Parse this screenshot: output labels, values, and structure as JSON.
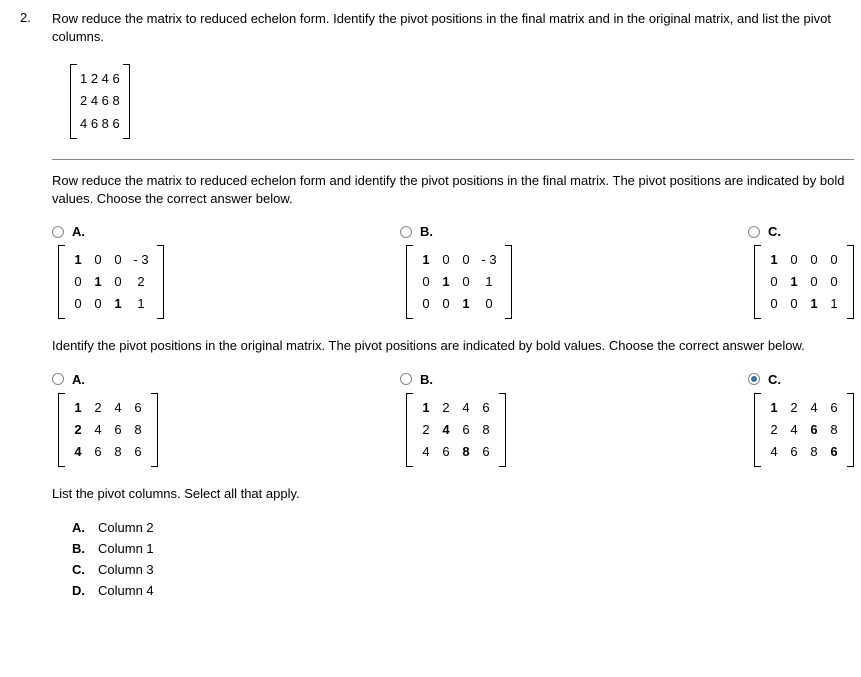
{
  "problem_number": "2.",
  "prompt": "Row reduce the matrix to reduced echelon form. Identify the pivot positions in the final matrix and in the original matrix, and list the pivot columns.",
  "given_matrix": {
    "rows": [
      "1 2 4 6",
      "2 4 6 8",
      "4 6 8 6"
    ]
  },
  "part1": {
    "prompt": "Row reduce the matrix to reduced echelon form and identify the pivot positions in the final matrix. The pivot positions are indicated by bold values. Choose the correct answer below.",
    "choices": [
      {
        "label": "A.",
        "matrix": [
          [
            {
              "t": "1",
              "b": true
            },
            {
              "t": "0"
            },
            {
              "t": "0"
            },
            {
              "t": "- 3",
              "w": true
            }
          ],
          [
            {
              "t": "0"
            },
            {
              "t": "1",
              "b": true
            },
            {
              "t": "0"
            },
            {
              "t": "2",
              "w": true
            }
          ],
          [
            {
              "t": "0"
            },
            {
              "t": "0"
            },
            {
              "t": "1",
              "b": true
            },
            {
              "t": "1",
              "w": true
            }
          ]
        ]
      },
      {
        "label": "B.",
        "matrix": [
          [
            {
              "t": "1",
              "b": true
            },
            {
              "t": "0"
            },
            {
              "t": "0"
            },
            {
              "t": "- 3",
              "w": true
            }
          ],
          [
            {
              "t": "0"
            },
            {
              "t": "1",
              "b": true
            },
            {
              "t": "0"
            },
            {
              "t": "1",
              "w": true
            }
          ],
          [
            {
              "t": "0"
            },
            {
              "t": "0"
            },
            {
              "t": "1",
              "b": true
            },
            {
              "t": "0",
              "w": true
            }
          ]
        ]
      },
      {
        "label": "C.",
        "matrix": [
          [
            {
              "t": "1",
              "b": true
            },
            {
              "t": "0"
            },
            {
              "t": "0"
            },
            {
              "t": "0"
            }
          ],
          [
            {
              "t": "0"
            },
            {
              "t": "1",
              "b": true
            },
            {
              "t": "0"
            },
            {
              "t": "0"
            }
          ],
          [
            {
              "t": "0"
            },
            {
              "t": "0"
            },
            {
              "t": "1",
              "b": true
            },
            {
              "t": "1"
            }
          ]
        ]
      }
    ]
  },
  "part2": {
    "prompt": "Identify the pivot positions in the original matrix. The pivot positions are indicated by bold values. Choose the correct answer below.",
    "choices": [
      {
        "label": "A.",
        "selected": false,
        "matrix": [
          [
            {
              "t": "1",
              "b": true
            },
            {
              "t": "2"
            },
            {
              "t": "4"
            },
            {
              "t": "6"
            }
          ],
          [
            {
              "t": "2",
              "b": true
            },
            {
              "t": "4"
            },
            {
              "t": "6"
            },
            {
              "t": "8"
            }
          ],
          [
            {
              "t": "4",
              "b": true
            },
            {
              "t": "6"
            },
            {
              "t": "8"
            },
            {
              "t": "6"
            }
          ]
        ]
      },
      {
        "label": "B.",
        "selected": false,
        "matrix": [
          [
            {
              "t": "1",
              "b": true
            },
            {
              "t": "2"
            },
            {
              "t": "4"
            },
            {
              "t": "6"
            }
          ],
          [
            {
              "t": "2"
            },
            {
              "t": "4",
              "b": true
            },
            {
              "t": "6"
            },
            {
              "t": "8"
            }
          ],
          [
            {
              "t": "4"
            },
            {
              "t": "6"
            },
            {
              "t": "8",
              "b": true
            },
            {
              "t": "6"
            }
          ]
        ]
      },
      {
        "label": "C.",
        "selected": true,
        "matrix": [
          [
            {
              "t": "1",
              "b": true
            },
            {
              "t": "2"
            },
            {
              "t": "4"
            },
            {
              "t": "6"
            }
          ],
          [
            {
              "t": "2"
            },
            {
              "t": "4"
            },
            {
              "t": "6",
              "b": true
            },
            {
              "t": "8"
            }
          ],
          [
            {
              "t": "4"
            },
            {
              "t": "6"
            },
            {
              "t": "8"
            },
            {
              "t": "6",
              "b": true
            }
          ]
        ]
      }
    ]
  },
  "part3": {
    "prompt": "List the pivot columns. Select all that apply.",
    "options": [
      {
        "letter": "A.",
        "text": "Column 2"
      },
      {
        "letter": "B.",
        "text": "Column 1"
      },
      {
        "letter": "C.",
        "text": "Column 3"
      },
      {
        "letter": "D.",
        "text": "Column 4"
      }
    ]
  },
  "chart_data": {
    "type": "table",
    "title": "Given matrix",
    "rows": [
      [
        1,
        2,
        4,
        6
      ],
      [
        2,
        4,
        6,
        8
      ],
      [
        4,
        6,
        8,
        6
      ]
    ]
  }
}
